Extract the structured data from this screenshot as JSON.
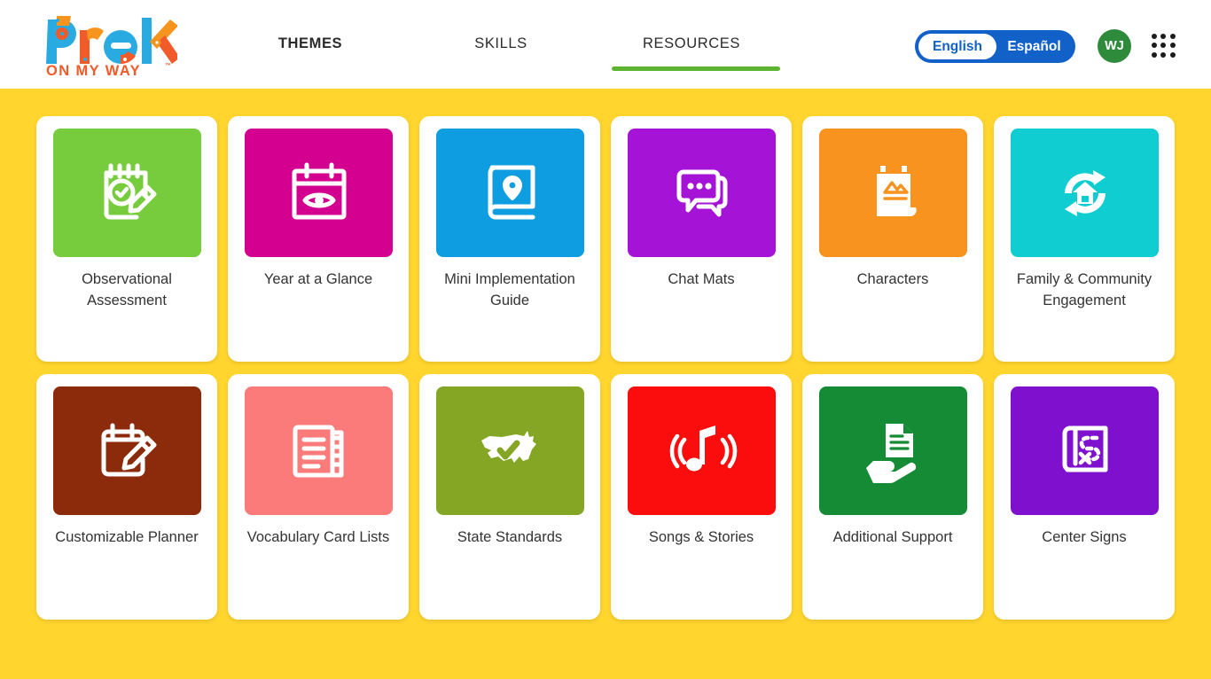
{
  "header": {
    "logo": {
      "name": "prek-on-my-way-logo",
      "wordmark": "PreK",
      "tagline": "ON MY WAY",
      "trademark": "™",
      "colors": {
        "blue": "#29ABE2",
        "orange": "#F7941E",
        "red_orange": "#F15A29"
      }
    },
    "nav": [
      {
        "id": "themes",
        "label": "THEMES",
        "active": false,
        "bold": true
      },
      {
        "id": "skills",
        "label": "SKILLS",
        "active": false,
        "bold": false
      },
      {
        "id": "resources",
        "label": "RESOURCES",
        "active": true,
        "bold": false
      }
    ],
    "nav_active_color": "#5CB531",
    "language_toggle": {
      "selected": "English",
      "options": [
        "English",
        "Español"
      ],
      "pill_color": "#1161C9"
    },
    "avatar": {
      "initials": "WJ",
      "color": "#2E8B3B"
    },
    "apps_button": {
      "icon": "apps-grid-icon",
      "dots": 9
    }
  },
  "page": {
    "background_color": "#FFD52E",
    "card_background": "#FFFFFF",
    "label_color": "#333333"
  },
  "cards": [
    {
      "id": "observational-assessment",
      "label": "Observational Assessment",
      "color": "#76CC3C",
      "icon": "notepad-check-pencil-icon"
    },
    {
      "id": "year-at-a-glance",
      "label": "Year at a Glance",
      "color": "#D4008F",
      "icon": "calendar-eye-icon"
    },
    {
      "id": "mini-implementation-guide",
      "label": "Mini Implementation Guide",
      "color": "#0D9DE0",
      "icon": "book-location-pin-icon"
    },
    {
      "id": "chat-mats",
      "label": "Chat Mats",
      "color": "#A413D6",
      "icon": "chat-bubbles-icon"
    },
    {
      "id": "characters",
      "label": "Characters",
      "color": "#F7931E",
      "icon": "easel-flipchart-icon"
    },
    {
      "id": "family-community-engagement",
      "label": "Family & Community Engagement",
      "color": "#0FCDD0",
      "icon": "house-refresh-icon"
    },
    {
      "id": "customizable-planner",
      "label": "Customizable Planner",
      "color": "#8C2B0B",
      "icon": "calendar-pencil-icon"
    },
    {
      "id": "vocabulary-card-lists",
      "label": "Vocabulary Card Lists",
      "color": "#FB7A7A",
      "icon": "card-list-stack-icon"
    },
    {
      "id": "state-standards",
      "label": "State Standards",
      "color": "#85A524",
      "icon": "usa-map-check-icon"
    },
    {
      "id": "songs-stories",
      "label": "Songs & Stories",
      "color": "#FC0D0D",
      "icon": "music-note-waves-icon"
    },
    {
      "id": "additional-support",
      "label": "Additional Support",
      "color": "#158B35",
      "icon": "hand-document-icon"
    },
    {
      "id": "center-signs",
      "label": "Center Signs",
      "color": "#7E10CE",
      "icon": "blueprint-path-icon"
    }
  ]
}
